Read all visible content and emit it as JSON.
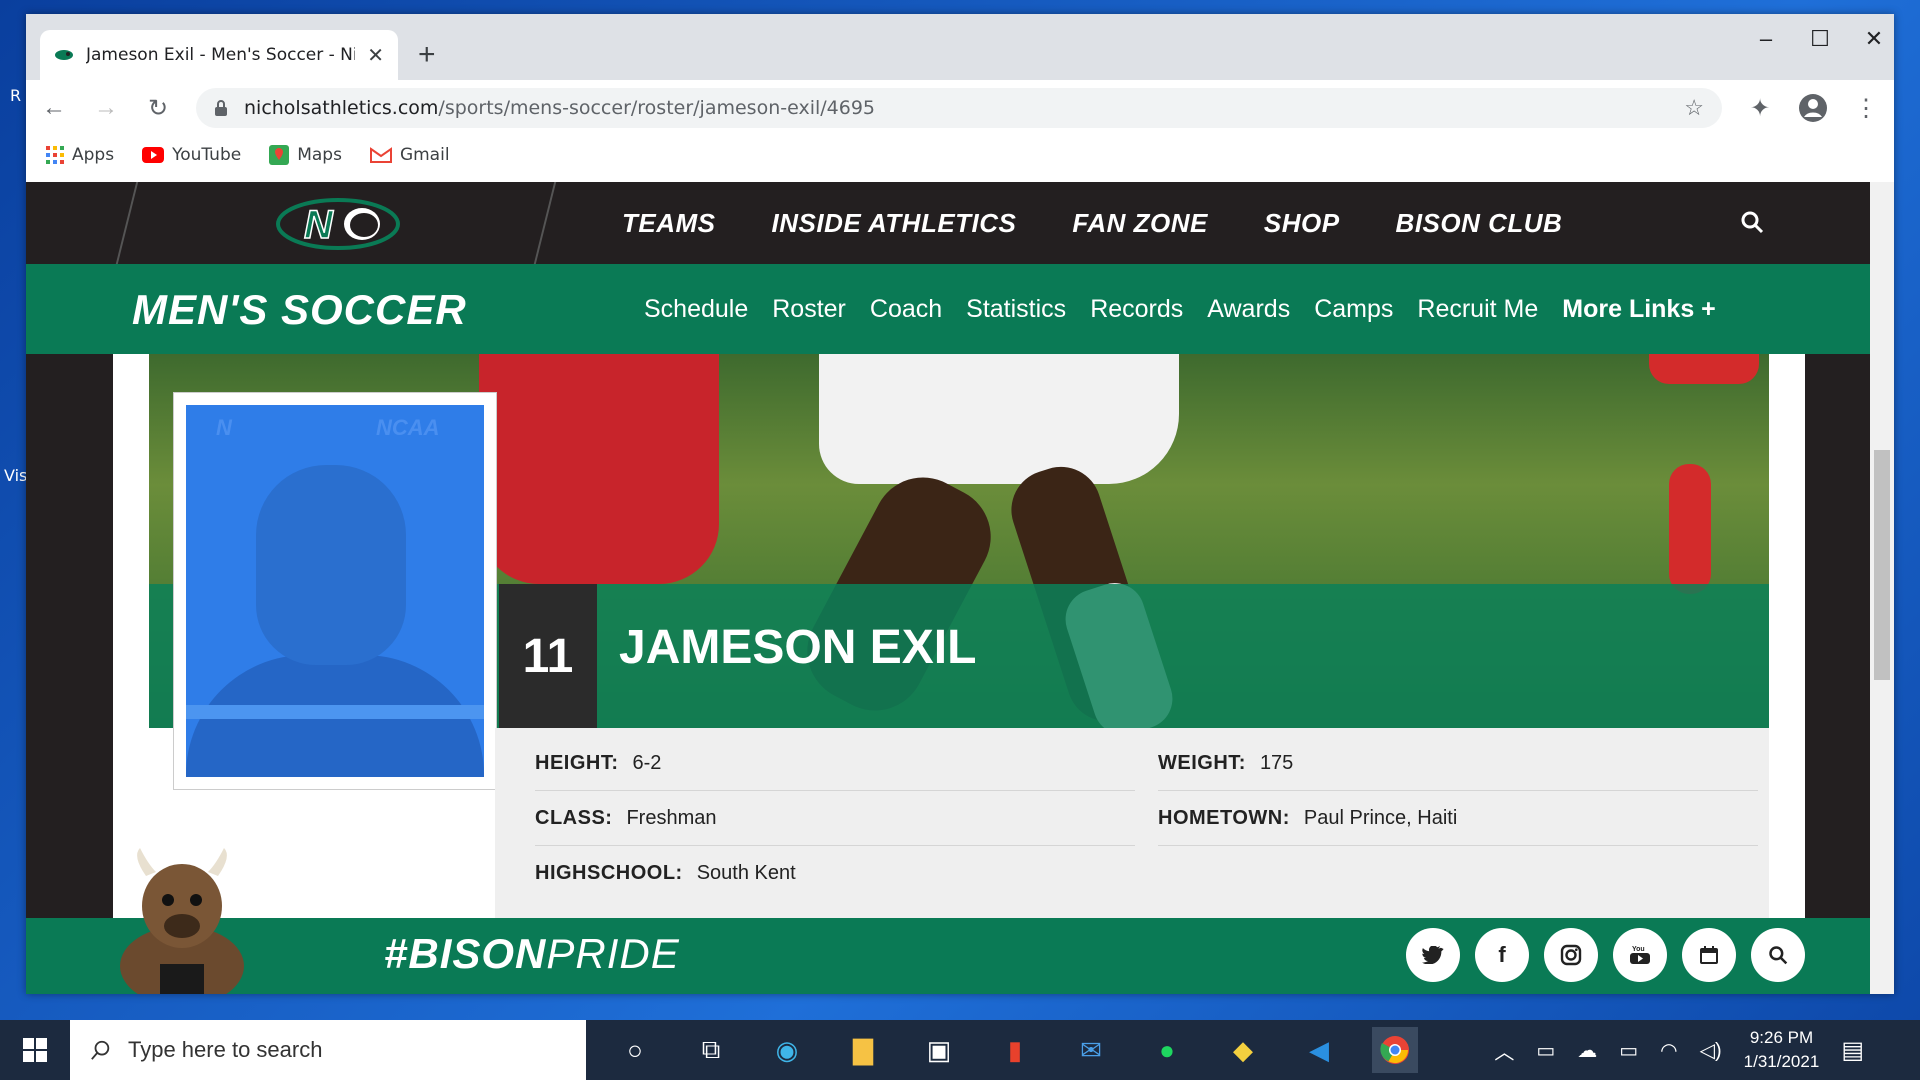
{
  "browser": {
    "tab_title": "Jameson Exil - Men's Soccer - Nic",
    "url_host": "nicholsathletics.com",
    "url_path": "/sports/mens-soccer/roster/jameson-exil/4695",
    "bookmarks": [
      {
        "label": "Apps",
        "icon": "apps-grid-icon"
      },
      {
        "label": "YouTube",
        "icon": "youtube-icon"
      },
      {
        "label": "Maps",
        "icon": "maps-icon"
      },
      {
        "label": "Gmail",
        "icon": "gmail-icon"
      }
    ]
  },
  "site": {
    "main_nav": [
      "TEAMS",
      "INSIDE ATHLETICS",
      "FAN ZONE",
      "SHOP",
      "BISON CLUB"
    ],
    "sport_title": "MEN'S SOCCER",
    "sport_nav": [
      "Schedule",
      "Roster",
      "Coach",
      "Statistics",
      "Records",
      "Awards",
      "Camps",
      "Recruit Me"
    ],
    "more_links": "More Links +"
  },
  "player": {
    "number": "11",
    "name": "JAMESON EXIL",
    "bio": [
      {
        "label": "HEIGHT:",
        "value": "6-2"
      },
      {
        "label": "WEIGHT:",
        "value": "175"
      },
      {
        "label": "CLASS:",
        "value": "Freshman"
      },
      {
        "label": "HOMETOWN:",
        "value": "Paul Prince, Haiti"
      },
      {
        "label": "HIGHSCHOOL:",
        "value": "South Kent"
      }
    ]
  },
  "footer": {
    "hashtag_bold": "#BISON",
    "hashtag_thin": "PRIDE",
    "social_icons": [
      "twitter-icon",
      "facebook-icon",
      "instagram-icon",
      "youtube-icon",
      "calendar-icon",
      "search-icon"
    ]
  },
  "taskbar": {
    "search_placeholder": "Type here to search",
    "time": "9:26 PM",
    "date": "1/31/2021"
  },
  "colors": {
    "brand_green": "#0a7a55",
    "dark": "#231f20"
  }
}
